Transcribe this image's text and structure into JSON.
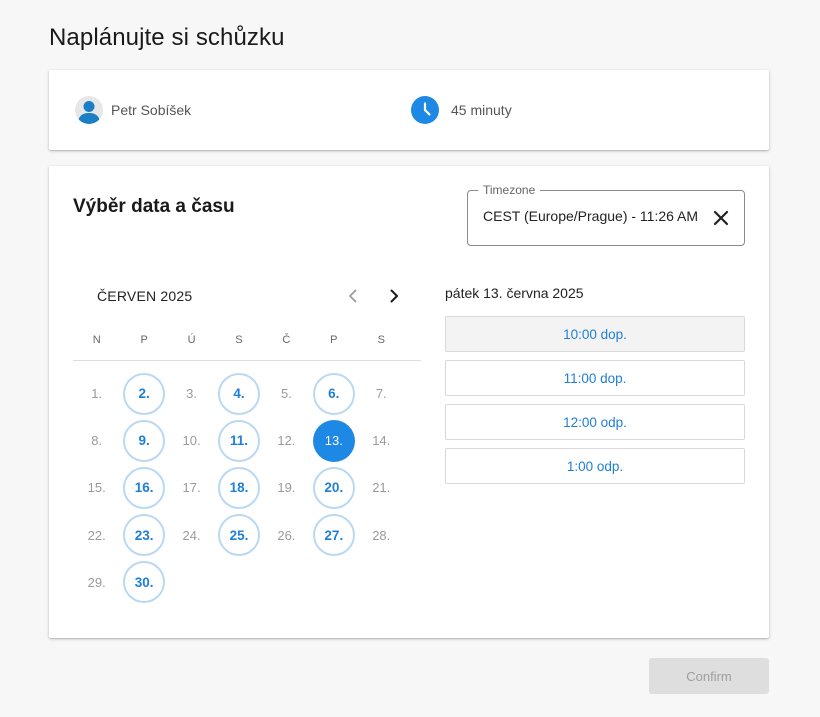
{
  "page": {
    "title": "Naplánujte si schůzku"
  },
  "info": {
    "host_name": "Petr Sobíšek",
    "duration": "45 minuty"
  },
  "picker": {
    "section_title": "Výběr data a času",
    "timezone": {
      "legend": "Timezone",
      "value": "CEST (Europe/Prague) - 11:26 AM"
    },
    "month_label": "ČERVEN 2025",
    "weekdays": [
      "N",
      "P",
      "Ú",
      "S",
      "Č",
      "P",
      "S"
    ],
    "days": [
      {
        "label": "1.",
        "state": "unavailable"
      },
      {
        "label": "2.",
        "state": "available"
      },
      {
        "label": "3.",
        "state": "unavailable"
      },
      {
        "label": "4.",
        "state": "available"
      },
      {
        "label": "5.",
        "state": "unavailable"
      },
      {
        "label": "6.",
        "state": "available"
      },
      {
        "label": "7.",
        "state": "unavailable"
      },
      {
        "label": "8.",
        "state": "unavailable"
      },
      {
        "label": "9.",
        "state": "available"
      },
      {
        "label": "10.",
        "state": "unavailable"
      },
      {
        "label": "11.",
        "state": "available"
      },
      {
        "label": "12.",
        "state": "unavailable"
      },
      {
        "label": "13.",
        "state": "selected"
      },
      {
        "label": "14.",
        "state": "unavailable"
      },
      {
        "label": "15.",
        "state": "unavailable"
      },
      {
        "label": "16.",
        "state": "available"
      },
      {
        "label": "17.",
        "state": "unavailable"
      },
      {
        "label": "18.",
        "state": "available"
      },
      {
        "label": "19.",
        "state": "unavailable"
      },
      {
        "label": "20.",
        "state": "available"
      },
      {
        "label": "21.",
        "state": "unavailable"
      },
      {
        "label": "22.",
        "state": "unavailable"
      },
      {
        "label": "23.",
        "state": "available"
      },
      {
        "label": "24.",
        "state": "unavailable"
      },
      {
        "label": "25.",
        "state": "available"
      },
      {
        "label": "26.",
        "state": "unavailable"
      },
      {
        "label": "27.",
        "state": "available"
      },
      {
        "label": "28.",
        "state": "unavailable"
      },
      {
        "label": "29.",
        "state": "unavailable"
      },
      {
        "label": "30.",
        "state": "available"
      }
    ],
    "selected_date_label": "pátek 13. června 2025",
    "time_slots": [
      {
        "label": "10:00 dop.",
        "active": true
      },
      {
        "label": "11:00 dop.",
        "active": false
      },
      {
        "label": "12:00 odp.",
        "active": false
      },
      {
        "label": "1:00 odp.",
        "active": false
      }
    ]
  },
  "actions": {
    "confirm_label": "Confirm"
  },
  "colors": {
    "accent": "#1e88e5",
    "available_ring": "#b9d9f3"
  },
  "icons": {
    "host": "person-icon",
    "duration": "clock-icon",
    "clear": "close-icon",
    "prev": "chevron-left-icon",
    "next": "chevron-right-icon"
  }
}
